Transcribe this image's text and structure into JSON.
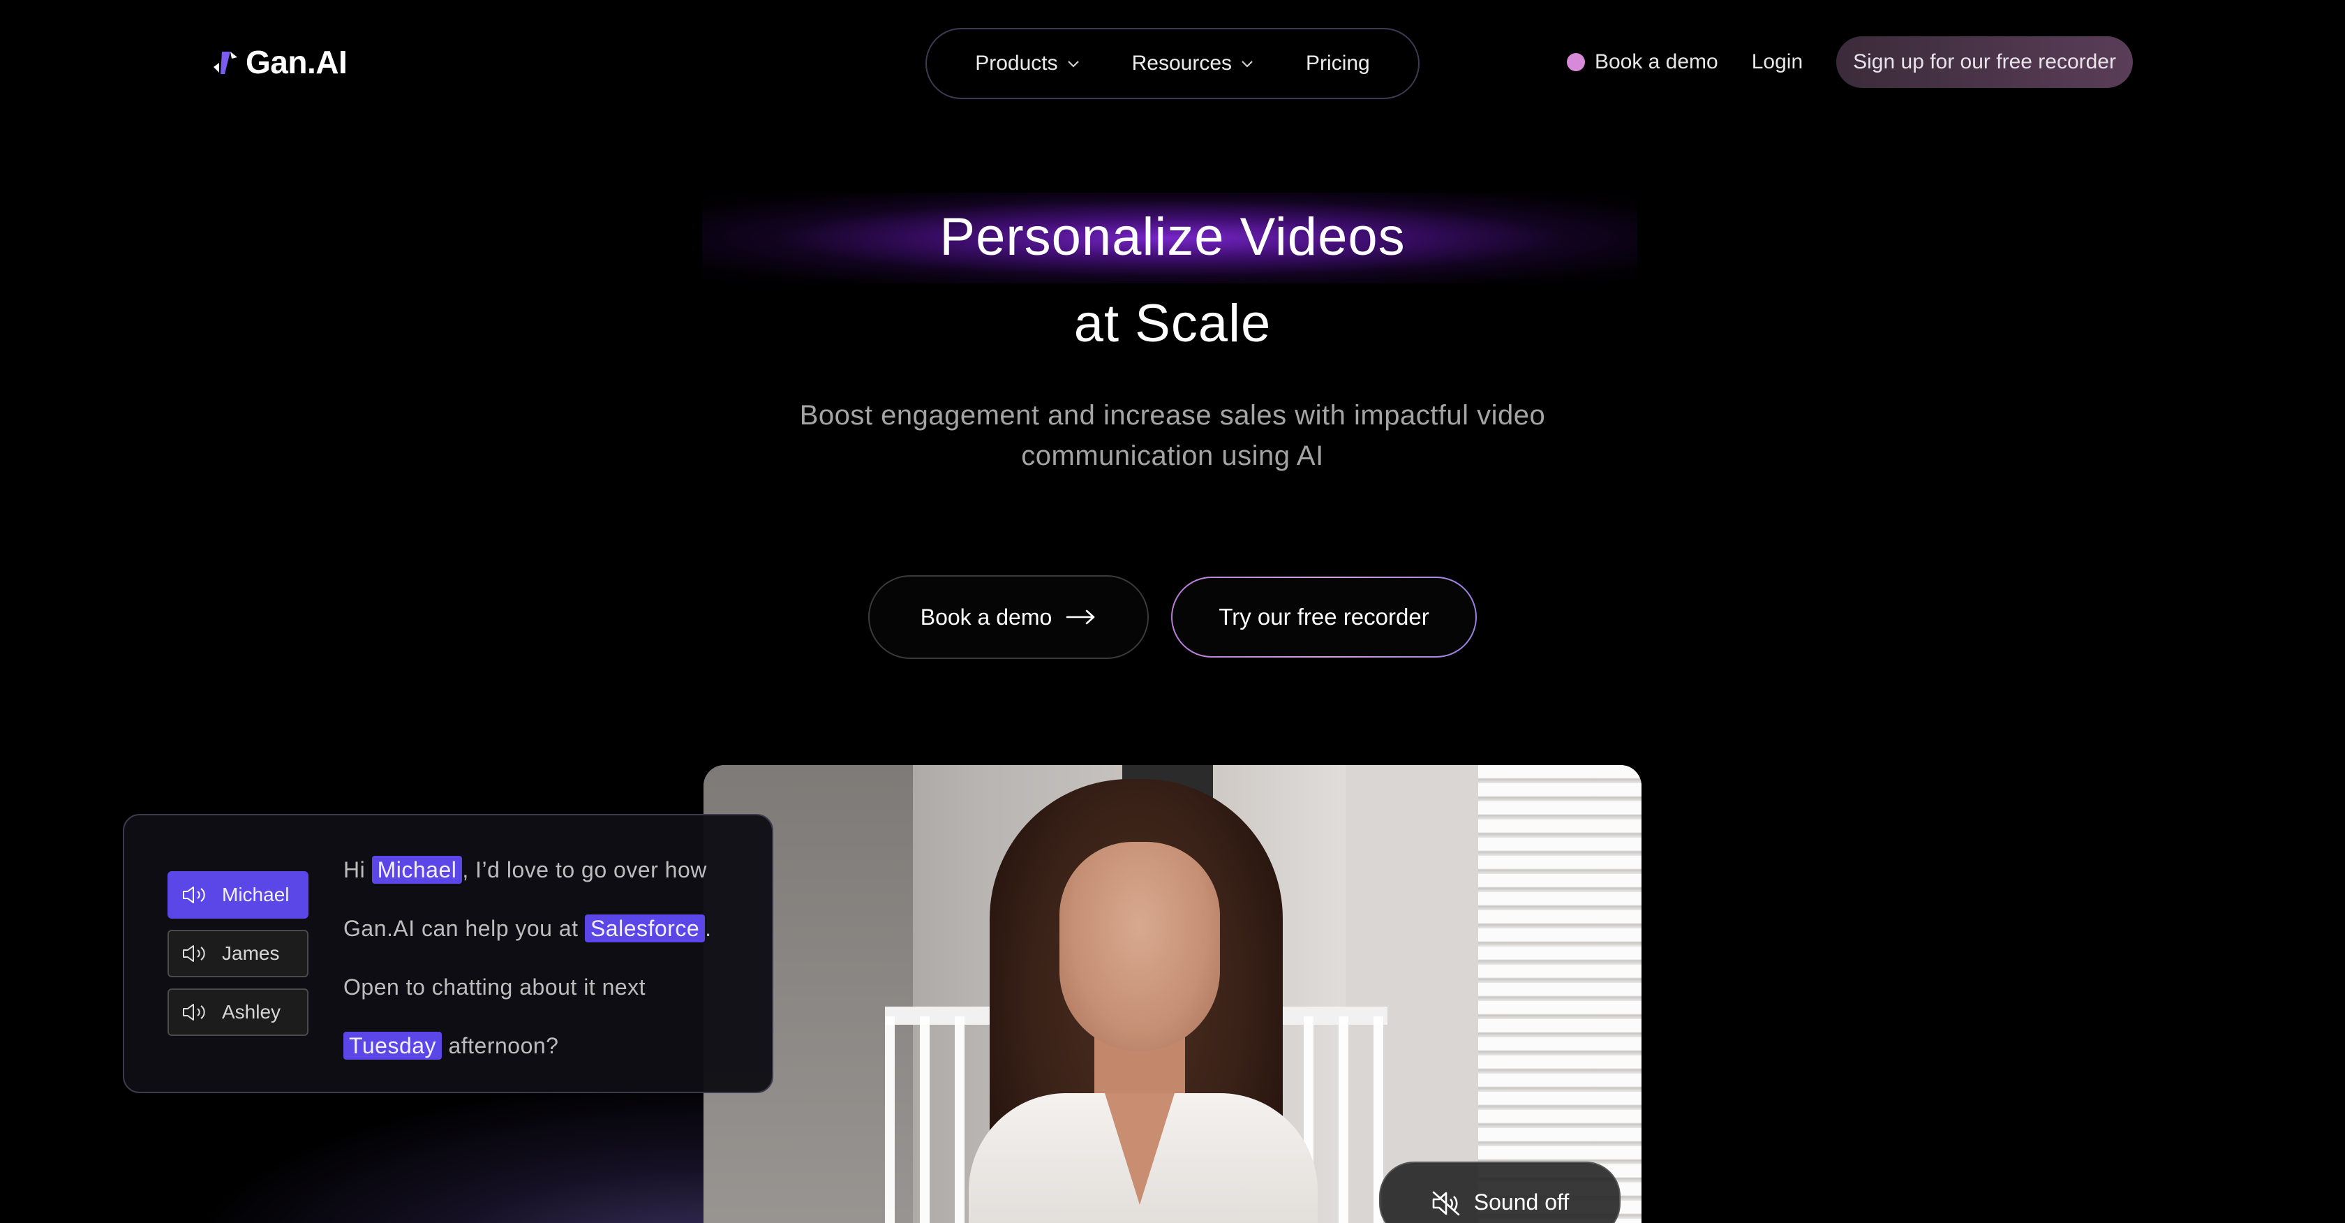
{
  "brand": {
    "name": "Gan.AI"
  },
  "nav": {
    "products": "Products",
    "resources": "Resources",
    "pricing": "Pricing",
    "book_demo": "Book a demo",
    "login": "Login",
    "signup": "Sign up for our free recorder"
  },
  "hero": {
    "title_line1": "Personalize Videos",
    "title_line2": "at Scale",
    "subtitle": "Boost engagement and increase sales with impactful video communication using AI",
    "cta_demo": "Book a demo",
    "cta_try": "Try our free recorder"
  },
  "personalization": {
    "names": [
      "Michael",
      "James",
      "Ashley"
    ],
    "active_name": "Michael",
    "script": {
      "greeting": "Hi",
      "name": "Michael",
      "part1": ", I’d love to go over how Gan.AI can help you at",
      "company": "Salesforce",
      "part2": ". Open to chatting about it next",
      "day": "Tuesday",
      "part3": "afternoon?"
    }
  },
  "video": {
    "sound_label": "Sound off"
  },
  "colors": {
    "accent": "#5b46e8",
    "glow": "#7d28d2",
    "demo_dot": "#d78ad8"
  },
  "icons": [
    "logo-icon",
    "chevron-down-icon",
    "arrow-right-icon",
    "speaker-icon",
    "mute-icon"
  ]
}
